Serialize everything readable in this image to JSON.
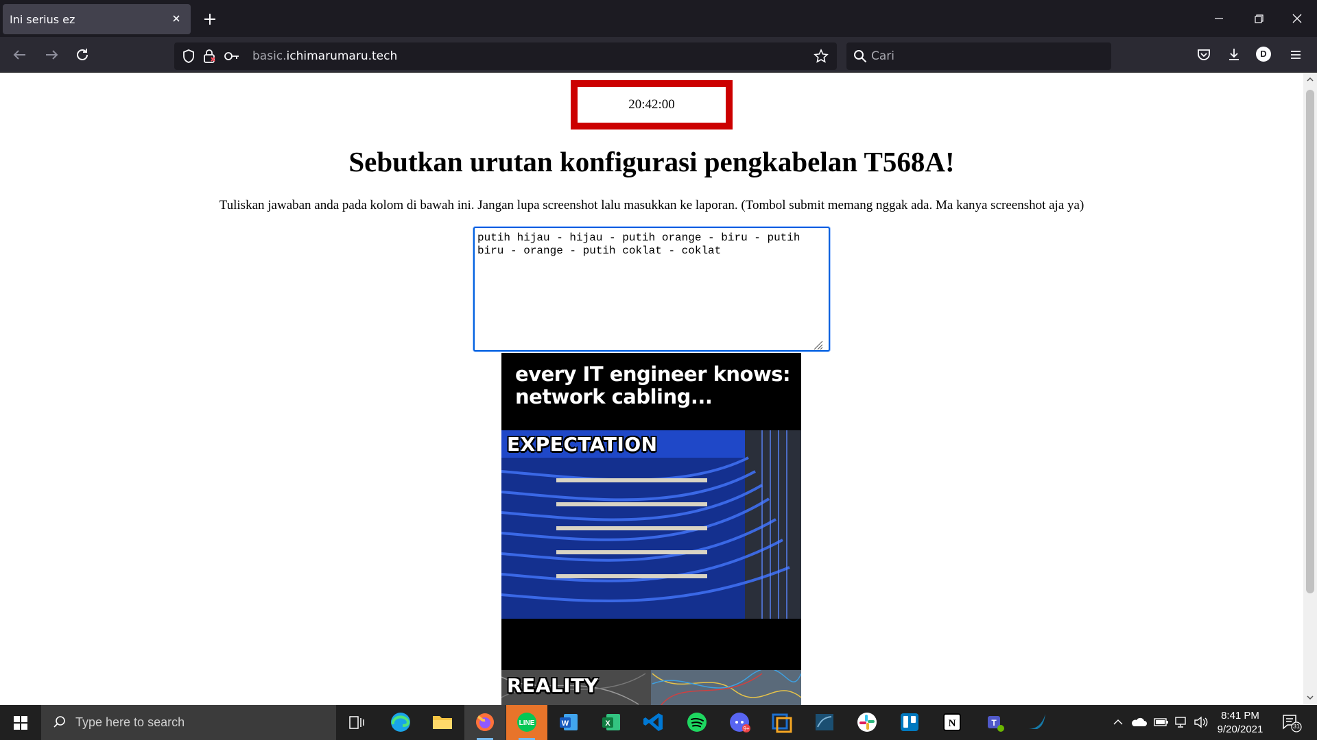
{
  "browser": {
    "tab": {
      "title": "Ini serius ez"
    },
    "url": {
      "prefix": "basic.",
      "domain": "ichimarumaru.tech"
    },
    "search_placeholder": "Cari",
    "profile_initial": "D"
  },
  "page": {
    "clock": "20:42:00",
    "heading": "Sebutkan urutan konfigurasi pengkabelan T568A!",
    "instruction": "Tuliskan jawaban anda pada kolom di bawah ini. Jangan lupa screenshot lalu masukkan ke laporan. (Tombol submit memang nggak ada. Ma kanya screenshot aja ya)",
    "answer_value": "putih hijau - hijau - putih orange - biru - putih biru - orange - putih coklat - coklat",
    "meme": {
      "caption_line1": "every IT engineer knows:",
      "caption_line2": "network cabling...",
      "label_top": "EXPECTATION",
      "label_bottom": "REALITY"
    }
  },
  "taskbar": {
    "search_placeholder": "Type here to search",
    "apps": [
      "task-view",
      "edge",
      "file-explorer",
      "firefox",
      "line",
      "word",
      "excel",
      "vscode",
      "spotify",
      "discord",
      "virtualbox",
      "mysql-workbench",
      "slack",
      "trello",
      "notion",
      "teams",
      "wireshark"
    ],
    "time": "8:41 PM",
    "date": "9/20/2021",
    "notification_count": "31"
  }
}
